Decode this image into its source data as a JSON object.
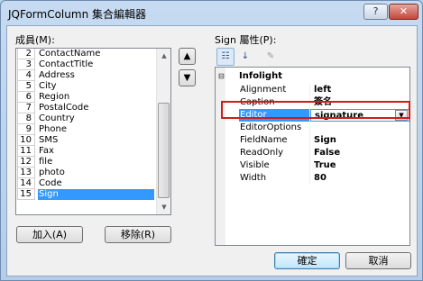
{
  "window": {
    "title": "JQFormColumn 集合編輯器",
    "help_label": "?",
    "close_label": "✕"
  },
  "members": {
    "label": "成員(M):",
    "items": [
      {
        "num": "2",
        "name": "ContactName"
      },
      {
        "num": "3",
        "name": "ContactTitle"
      },
      {
        "num": "4",
        "name": "Address"
      },
      {
        "num": "5",
        "name": "City"
      },
      {
        "num": "6",
        "name": "Region"
      },
      {
        "num": "7",
        "name": "PostalCode"
      },
      {
        "num": "8",
        "name": "Country"
      },
      {
        "num": "9",
        "name": "Phone"
      },
      {
        "num": "10",
        "name": "SMS"
      },
      {
        "num": "11",
        "name": "Fax"
      },
      {
        "num": "12",
        "name": "file"
      },
      {
        "num": "13",
        "name": "photo"
      },
      {
        "num": "14",
        "name": "Code"
      },
      {
        "num": "15",
        "name": "Sign"
      }
    ],
    "selected_index": 13,
    "add_label": "加入(A)",
    "remove_label": "移除(R)"
  },
  "properties": {
    "label": "Sign 屬性(P):",
    "category": "Infolight",
    "rows": [
      {
        "name": "Alignment",
        "value": "left"
      },
      {
        "name": "Caption",
        "value": "簽名"
      },
      {
        "name": "Editor",
        "value": "signature"
      },
      {
        "name": "EditorOptions",
        "value": ""
      },
      {
        "name": "FieldName",
        "value": "Sign"
      },
      {
        "name": "ReadOnly",
        "value": "False"
      },
      {
        "name": "Visible",
        "value": "True"
      },
      {
        "name": "Width",
        "value": "80"
      }
    ],
    "selected_row": 2
  },
  "buttons": {
    "ok_label": "確定",
    "cancel_label": "取消"
  },
  "icons": {
    "move_up": "up-arrow-icon",
    "move_down": "down-arrow-icon",
    "categorized": "categorized-icon",
    "alphabetical": "alphabetical-icon",
    "property_pages": "wrench-icon"
  }
}
